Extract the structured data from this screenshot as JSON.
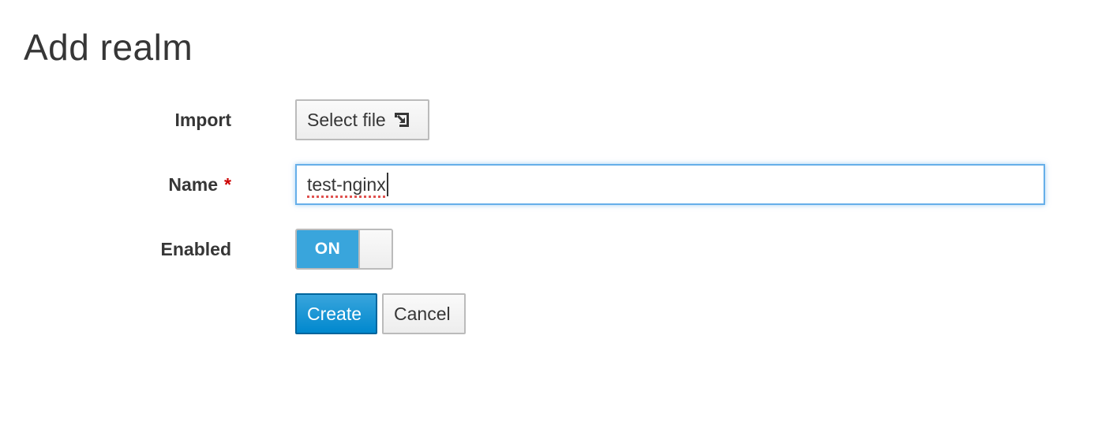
{
  "page": {
    "title": "Add realm"
  },
  "form": {
    "import": {
      "label": "Import",
      "button_label": "Select file",
      "icon": "file-import-icon"
    },
    "name": {
      "label": "Name",
      "required_marker": "*",
      "value": "test-nginx"
    },
    "enabled": {
      "label": "Enabled",
      "state_label": "ON",
      "value": true
    },
    "actions": {
      "create_label": "Create",
      "cancel_label": "Cancel"
    }
  },
  "colors": {
    "primary": "#0088ce",
    "toggle_on": "#39a5dc",
    "focus_border": "#66afe9",
    "required": "#cc0000",
    "text": "#363636"
  }
}
